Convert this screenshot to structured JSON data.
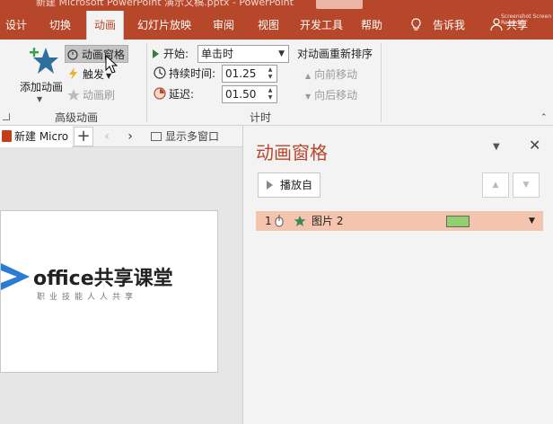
{
  "title_bar": {
    "text": "新建 Microsoft PowerPoint 演示文稿.pptx - PowerPoint"
  },
  "tabs": [
    {
      "label": "设计"
    },
    {
      "label": "切换"
    },
    {
      "label": "动画"
    },
    {
      "label": "幻灯片放映"
    },
    {
      "label": "审阅"
    },
    {
      "label": "视图"
    },
    {
      "label": "开发工具"
    },
    {
      "label": "帮助"
    },
    {
      "label": "告诉我"
    }
  ],
  "share_label": "共享",
  "watermark": "Screenshot Screen Recorder",
  "ribbon": {
    "add_animation": "添加动画",
    "animation_pane": "动画窗格",
    "trigger": "触发",
    "animation_painter": "动画刷",
    "advanced_group": "高级动画",
    "start_label": "开始:",
    "start_value": "单击时",
    "duration_label": "持续时间:",
    "duration_value": "01.25",
    "delay_label": "延迟:",
    "delay_value": "01.50",
    "timing_group": "计时",
    "reorder_title": "对动画重新排序",
    "move_earlier": "向前移动",
    "move_later": "向后移动"
  },
  "editor": {
    "doc_tab": "新建 Micro",
    "new_tab": "+",
    "back": "‹",
    "forward": "›",
    "multi_window": "显示多窗口"
  },
  "slide": {
    "logo_text": "office共享课堂",
    "logo_sub": "职业技能人人共享"
  },
  "pane": {
    "title": "动画窗格",
    "options": "▼",
    "close": "✕",
    "play_label": "播放自",
    "up": "▲",
    "down": "▼",
    "items": [
      {
        "order": "1",
        "name": "图片 2",
        "bar_color": "#92d06d"
      }
    ]
  },
  "colors": {
    "accent": "#b7472a",
    "highlight_row": "#f5c4ae"
  }
}
